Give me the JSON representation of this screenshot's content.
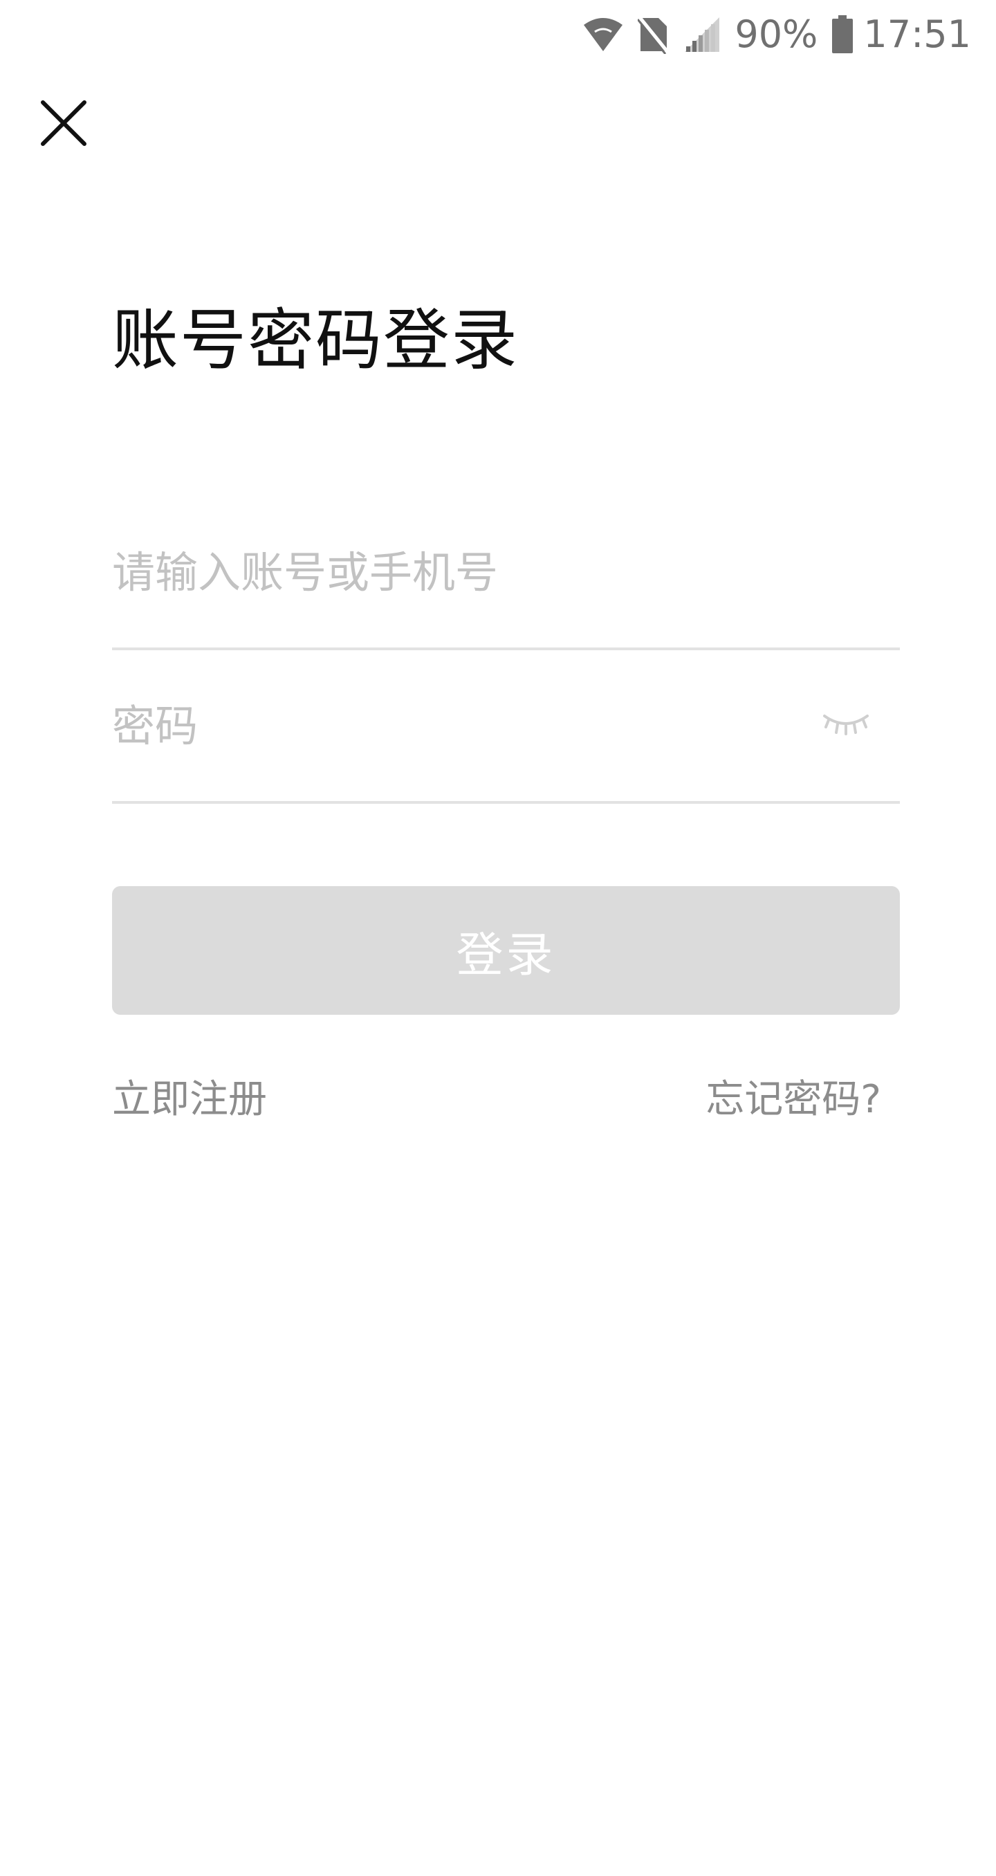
{
  "status_bar": {
    "battery_percent": "90%",
    "time": "17:51",
    "icons": [
      "wifi-icon",
      "no-sim-icon",
      "signal-icon",
      "battery-icon"
    ]
  },
  "header": {
    "close_icon": "close-icon"
  },
  "main": {
    "title": "账号密码登录",
    "account_field": {
      "placeholder": "请输入账号或手机号",
      "value": ""
    },
    "password_field": {
      "placeholder": "密码",
      "value": "",
      "toggle_icon": "eye-closed-icon"
    },
    "login_button_label": "登录",
    "register_link": "立即注册",
    "forgot_link": "忘记密码?"
  },
  "colors": {
    "title": "#111111",
    "placeholder": "#c2c2c2",
    "divider": "#e2e2e2",
    "button_disabled_bg": "#dbdbdb",
    "button_text": "#ffffff",
    "link": "#8c8c8c",
    "status": "#707070"
  }
}
